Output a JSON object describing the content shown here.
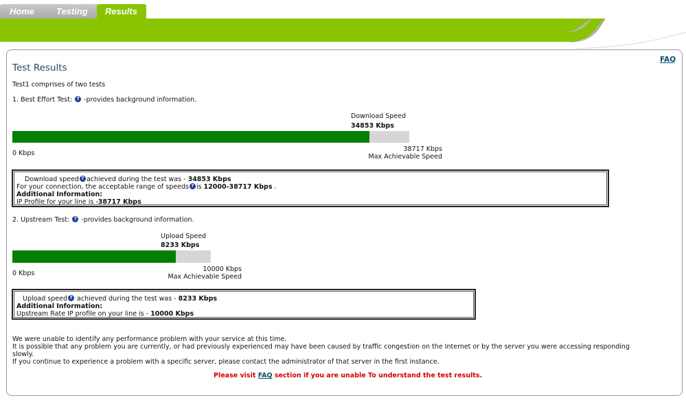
{
  "tabs": [
    {
      "label": "Home"
    },
    {
      "label": "Testing"
    },
    {
      "label": "Results"
    }
  ],
  "faq_link": "FAQ",
  "title": "Test Results",
  "intro": "Test1 comprises of two tests",
  "test1": {
    "heading_prefix": "1. Best Effort Test:",
    "heading_suffix": "-provides background information.",
    "speed_label": "Download Speed",
    "speed_value": "34853 Kbps",
    "min_label": "0 Kbps",
    "max_value": "38717 Kbps",
    "max_label": "Max Achievable Speed",
    "fraction": 0.9002,
    "box": {
      "line1_pre": "Download speed",
      "line1_mid": "achieved during the test was - ",
      "line1_val": "34853 Kbps",
      "line2_pre": "For your connection, the acceptable range of speeds",
      "line2_mid": "is ",
      "line2_val": "12000-38717 Kbps",
      "line2_end": ".",
      "line3": "Additional Information:",
      "line4_pre": "IP Profile for your line is -",
      "line4_val": "38717 Kbps"
    }
  },
  "test2": {
    "heading_prefix": "2. Upstream Test:",
    "heading_suffix": "-provides background information.",
    "speed_label": "Upload Speed",
    "speed_value": "8233 Kbps",
    "min_label": "0 Kbps",
    "max_value": "10000 Kbps",
    "max_label": "Max Achievable Speed",
    "fraction": 0.8233,
    "box": {
      "line1_pre": "Upload speed",
      "line1_mid": " achieved during the test was - ",
      "line1_val": "8233 Kbps",
      "line2": "Additional Information:",
      "line3_pre": "Upstream Rate IP profile on your line is - ",
      "line3_val": "10000 Kbps"
    }
  },
  "footer": {
    "p1": "We were unable to identify any performance problem with your service at this time.",
    "p2a": "It is possible that any problem you are currently, or had previously experienced may have been caused by traffic congestion on the Internet or by the server you were accessing responding",
    "p2b": "slowly.",
    "p3": "If you continue to experience a problem with a specific server, please contact the administrator of that server in the first instance.",
    "notice_pre": "Please visit ",
    "notice_link": "FAQ",
    "notice_post": " section if you are unable To understand the test results."
  },
  "colors": {
    "accent_green": "#88c400",
    "bar_green": "#047f04",
    "bar_grey": "#d6d6d6",
    "warning_red": "#d40000",
    "help_icon_blue": "#1d3f9e"
  },
  "icons": {
    "help": "question-circle-icon"
  }
}
